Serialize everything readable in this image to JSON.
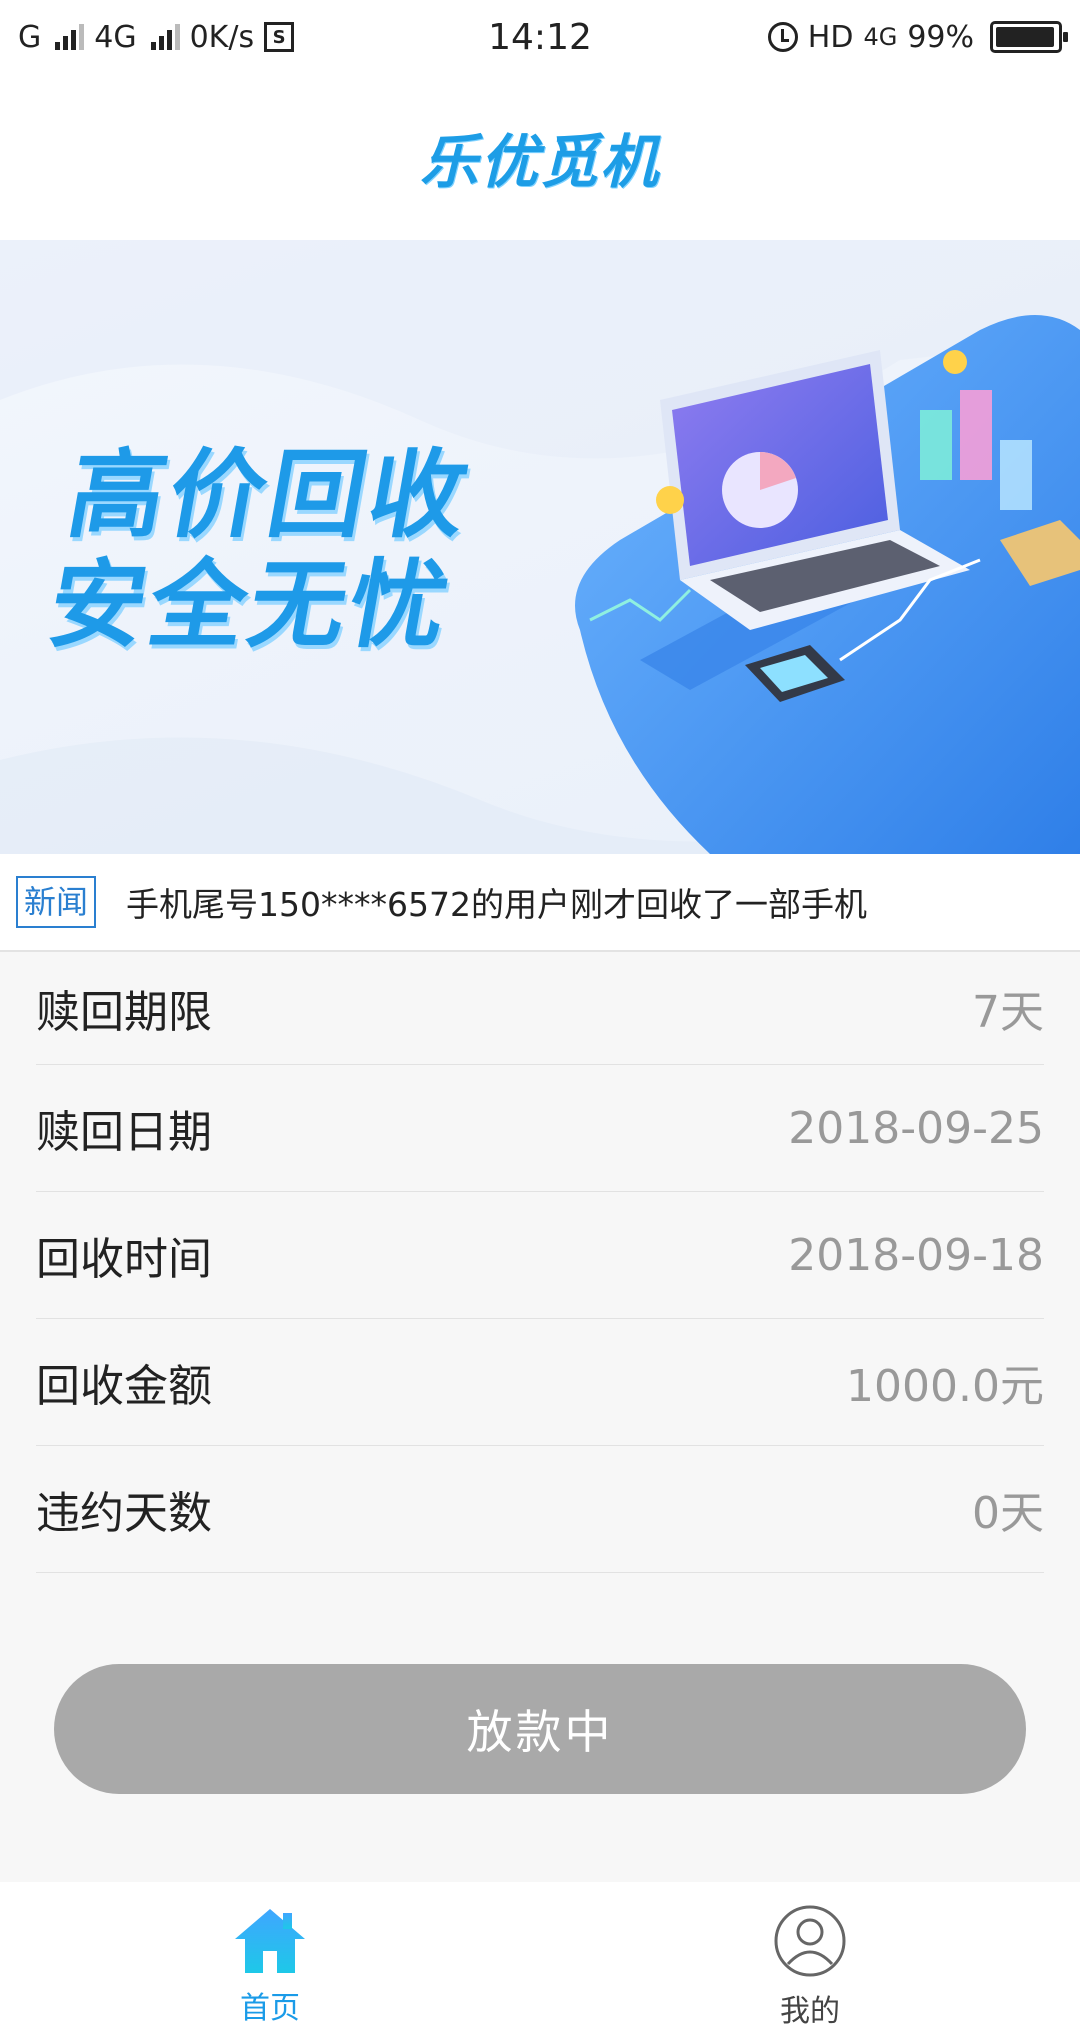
{
  "status_bar": {
    "carrier1": "G",
    "carrier2": "4G",
    "speed": "0K/s",
    "time": "14:12",
    "hd": "HD",
    "net": "4G",
    "battery": "99%"
  },
  "header": {
    "title": "乐优觅机"
  },
  "banner": {
    "line1": "高价回收",
    "line2": "安全无忧"
  },
  "news": {
    "tag": "新闻",
    "text": "手机尾号150****6572的用户刚才回收了一部手机"
  },
  "info": [
    {
      "label": "赎回期限",
      "value": "7天"
    },
    {
      "label": "赎回日期",
      "value": "2018-09-25"
    },
    {
      "label": "回收时间",
      "value": "2018-09-18"
    },
    {
      "label": "回收金额",
      "value": "1000.0元"
    },
    {
      "label": "违约天数",
      "value": "0天"
    }
  ],
  "button": {
    "label": "放款中"
  },
  "tabs": [
    {
      "label": "首页",
      "icon": "home-icon",
      "active": true
    },
    {
      "label": "我的",
      "icon": "user-icon",
      "active": false
    }
  ],
  "colors": {
    "accent": "#1a9be8",
    "button_disabled": "#a9a9a9"
  }
}
